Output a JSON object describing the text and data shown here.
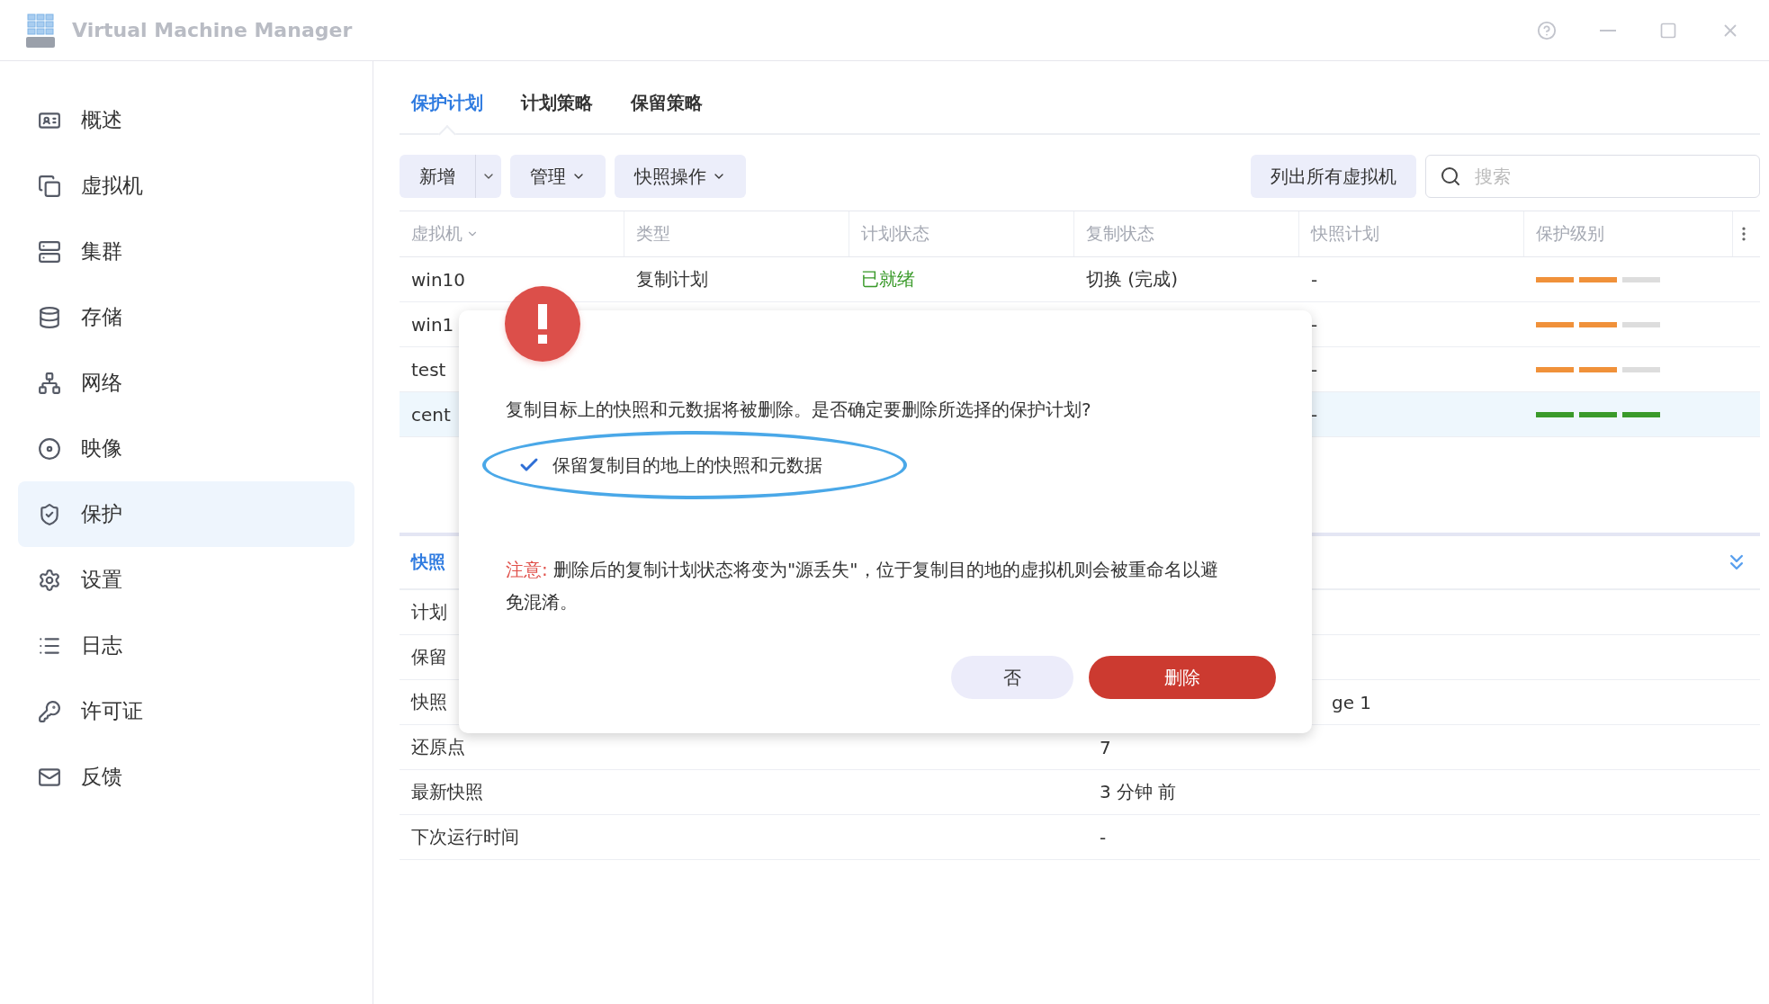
{
  "window": {
    "title": "Virtual Machine Manager"
  },
  "sidebar": {
    "items": [
      {
        "label": "概述",
        "selected": false
      },
      {
        "label": "虚拟机",
        "selected": false
      },
      {
        "label": "集群",
        "selected": false
      },
      {
        "label": "存储",
        "selected": false
      },
      {
        "label": "网络",
        "selected": false
      },
      {
        "label": "映像",
        "selected": false
      },
      {
        "label": "保护",
        "selected": true
      },
      {
        "label": "设置",
        "selected": false
      },
      {
        "label": "日志",
        "selected": false
      },
      {
        "label": "许可证",
        "selected": false
      },
      {
        "label": "反馈",
        "selected": false
      }
    ]
  },
  "tabs": [
    {
      "label": "保护计划",
      "selected": true
    },
    {
      "label": "计划策略",
      "selected": false
    },
    {
      "label": "保留策略",
      "selected": false
    }
  ],
  "toolbar": {
    "split_button": "新增",
    "menus": [
      "管理",
      "快照操作"
    ],
    "list_button": "列出所有虚拟机",
    "search": {
      "placeholder": "搜索"
    }
  },
  "table": {
    "columns": [
      {
        "label": "虚拟机",
        "sorted": true
      },
      {
        "label": "类型",
        "sorted": false
      },
      {
        "label": "计划状态",
        "sorted": false
      },
      {
        "label": "复制状态",
        "sorted": false
      },
      {
        "label": "快照计划",
        "sorted": false
      },
      {
        "label": "保护级别",
        "sorted": false
      }
    ],
    "rows": [
      {
        "selected": false,
        "vm": "win10",
        "type": "复制计划",
        "plan_status": {
          "text": "已就绪",
          "color": "#3a9a2a"
        },
        "replication_status": "切换 (完成)",
        "snapshot_plan": "-",
        "protection": [
          {
            "color": "#f0913a"
          },
          {
            "color": "#f0913a"
          },
          {
            "color": "#dddddd"
          }
        ]
      },
      {
        "selected": false,
        "vm": "win1",
        "snapshot_plan": "-",
        "protection": [
          {
            "color": "#f0913a"
          },
          {
            "color": "#f0913a"
          },
          {
            "color": "#dddddd"
          }
        ]
      },
      {
        "selected": false,
        "vm": "test",
        "snapshot_plan": "-",
        "protection": [
          {
            "color": "#f0913a"
          },
          {
            "color": "#f0913a"
          },
          {
            "color": "#dddddd"
          }
        ]
      },
      {
        "selected": true,
        "vm": "cent",
        "snapshot_plan": "-",
        "protection": [
          {
            "color": "#3a9a2a"
          },
          {
            "color": "#3a9a2a"
          },
          {
            "color": "#3a9a2a"
          }
        ]
      }
    ]
  },
  "details": {
    "tab": "快照",
    "rows": [
      {
        "label": "计划"
      },
      {
        "label": "保留"
      },
      {
        "label": "快照",
        "value_tail": "ge 1"
      },
      {
        "label": "还原点",
        "value": "7"
      },
      {
        "label": "最新快照",
        "value": "3 分钟 前"
      },
      {
        "label": "下次运行时间",
        "value": "-"
      }
    ]
  },
  "dialog": {
    "message": "复制目标上的快照和元数据将被删除。是否确定要删除所选择的保护计划?",
    "option": {
      "label": "保留复制目的地上的快照和元数据",
      "checked": true
    },
    "note_label": "注意:",
    "note": "删除后的复制计划状态将变为\"源丢失\"，位于复制目的地的虚拟机则会被重命名以避免混淆。",
    "buttons": [
      {
        "label": "否",
        "kind": "secondary"
      },
      {
        "label": "删除",
        "kind": "danger"
      }
    ]
  }
}
